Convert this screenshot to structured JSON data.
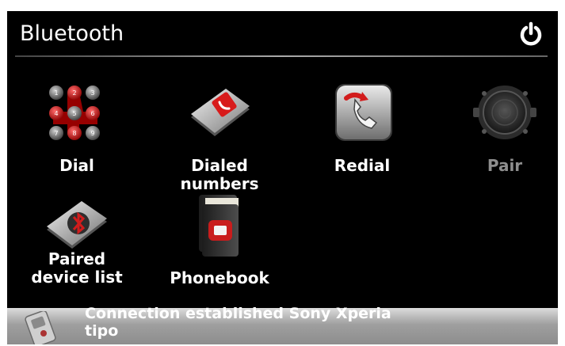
{
  "header": {
    "title": "Bluetooth",
    "power_icon": "power-icon"
  },
  "menu": [
    {
      "label": "Dial",
      "icon": "dial-keypad-icon",
      "enabled": true
    },
    {
      "label": "Dialed numbers",
      "icon": "dialed-numbers-icon",
      "enabled": true
    },
    {
      "label": "Redial",
      "icon": "redial-icon",
      "enabled": true
    },
    {
      "label": "Pair",
      "icon": "pair-radar-icon",
      "enabled": false
    },
    {
      "label": "Paired device list",
      "icon": "paired-device-list-icon",
      "enabled": true
    },
    {
      "label": "Phonebook",
      "icon": "phonebook-icon",
      "enabled": true
    }
  ],
  "keypad_digits": [
    "1",
    "2",
    "3",
    "4",
    "5",
    "6",
    "7",
    "8",
    "9"
  ],
  "status": {
    "text": "Connection established Sony Xperia tipo",
    "icon": "phone-icon"
  },
  "colors": {
    "background": "#000000",
    "accent_red": "#cc1f1f",
    "disabled_text": "#8e8e8e"
  }
}
